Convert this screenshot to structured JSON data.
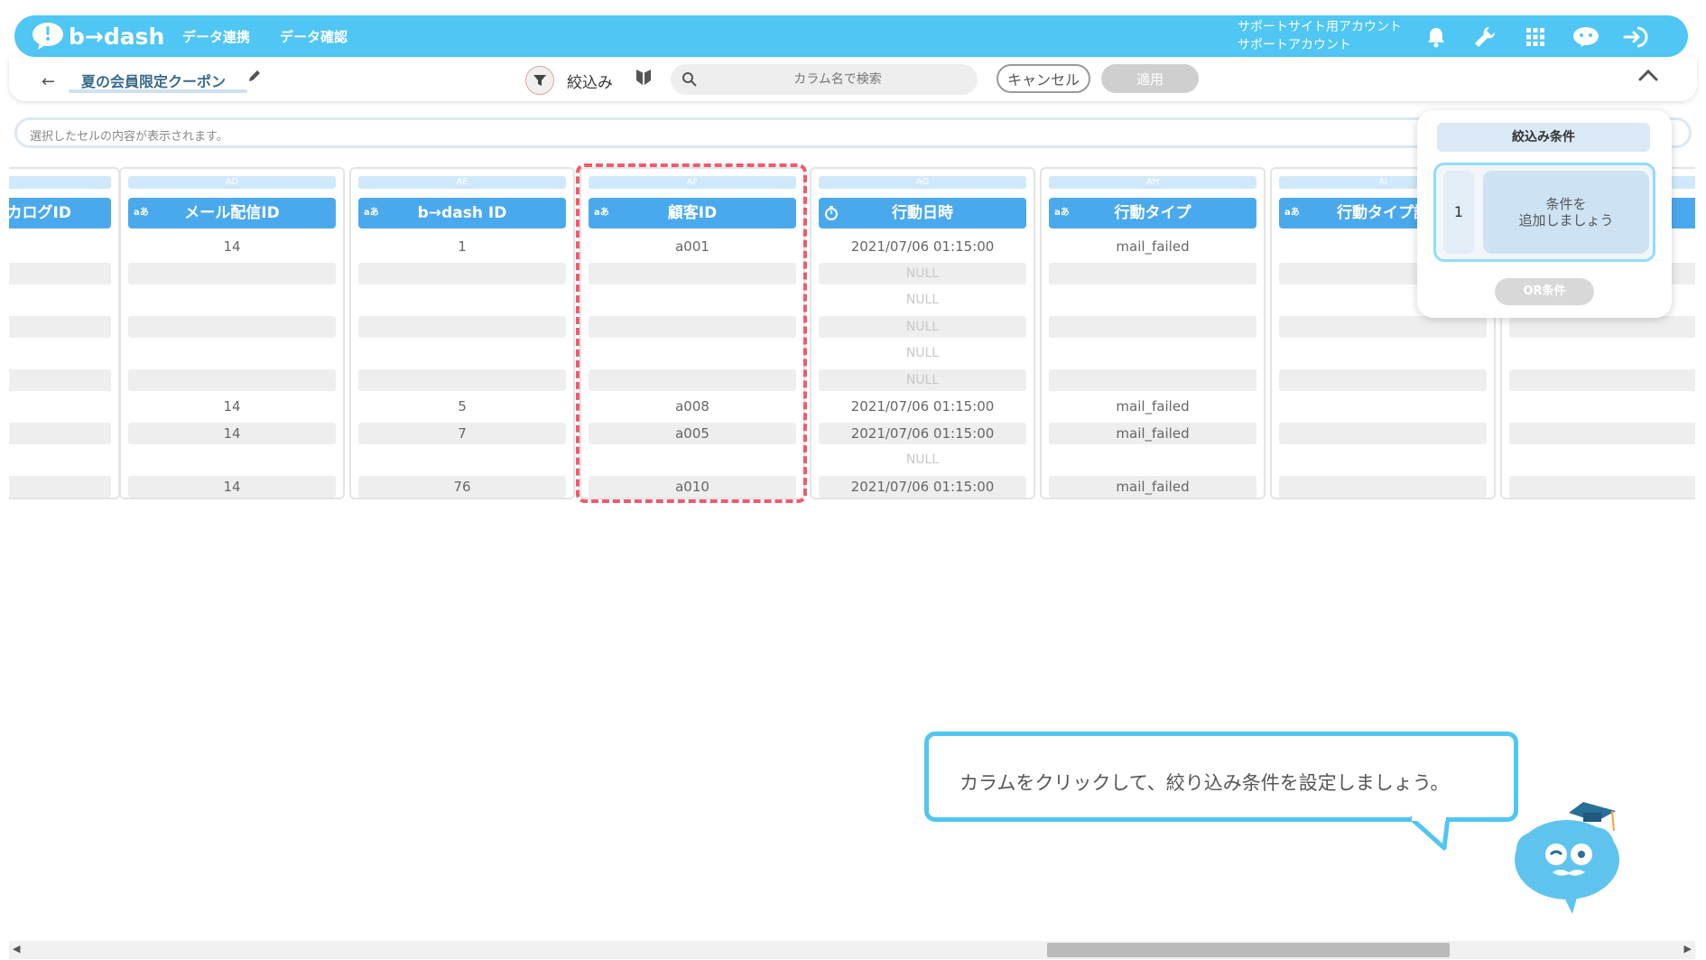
{
  "navbar": {
    "logo_text": "b→dash",
    "links": [
      "データ連携",
      "データ確認"
    ],
    "account_line1": "サポートサイト用アカウント",
    "account_line2": "サポートアカウント",
    "icons": [
      "bell-icon",
      "wrench-icon",
      "grid-apps-icon",
      "mascot-chat-icon",
      "logout-icon"
    ],
    "color": "#4fc6f4"
  },
  "subbar": {
    "title": "夏の会員限定クーポン",
    "filter_label": "絞込み",
    "search_placeholder": "カラム名で検索",
    "cancel_label": "キャンセル",
    "apply_label": "適用"
  },
  "cell_bar": {
    "placeholder": "選択したセルの内容が表示されます。"
  },
  "columns": [
    {
      "letter": "",
      "type": "",
      "name": "カログID",
      "cells": [
        "",
        "",
        "",
        "",
        "",
        "",
        "",
        "",
        "",
        ""
      ]
    },
    {
      "letter": "AD",
      "type": "aあ",
      "name": "メール配信ID",
      "cells": [
        "14",
        "",
        "",
        "",
        "",
        "",
        "14",
        "14",
        "",
        "14"
      ]
    },
    {
      "letter": "AE",
      "type": "aあ",
      "name": "b→dash ID",
      "cells": [
        "1",
        "",
        "",
        "",
        "",
        "",
        "5",
        "7",
        "",
        "76"
      ]
    },
    {
      "letter": "AF",
      "type": "aあ",
      "name": "顧客ID",
      "cells": [
        "a001",
        "",
        "",
        "",
        "",
        "",
        "a008",
        "a005",
        "",
        "a010"
      ]
    },
    {
      "letter": "AG",
      "type": "clock",
      "name": "行動日時",
      "cells": [
        "2021/07/06 01:15:00",
        "NULL",
        "NULL",
        "NULL",
        "NULL",
        "NULL",
        "2021/07/06 01:15:00",
        "2021/07/06 01:15:00",
        "NULL",
        "2021/07/06 01:15:00"
      ]
    },
    {
      "letter": "AH",
      "type": "aあ",
      "name": "行動タイプ",
      "cells": [
        "mail_failed",
        "",
        "",
        "",
        "",
        "",
        "mail_failed",
        "mail_failed",
        "",
        "mail_failed"
      ]
    },
    {
      "letter": "AI",
      "type": "aあ",
      "name": "行動タイプ詳",
      "cells": [
        "",
        "",
        "",
        "",
        "",
        "",
        "",
        "",
        "",
        ""
      ]
    },
    {
      "letter": "",
      "type": "",
      "name": "",
      "cells": [
        "",
        "",
        "",
        "",
        "",
        "",
        "",
        "",
        "",
        ""
      ]
    }
  ],
  "popup": {
    "title": "絞込み条件",
    "cond_number": "1",
    "cond_add_line1": "条件を",
    "cond_add_line2": "追加しましょう",
    "or_label": "OR条件"
  },
  "tooltip": {
    "text": "カラムをクリックして、絞り込み条件を設定しましょう。"
  },
  "colors": {
    "header_blue": "#4aa9ec",
    "highlight_red": "#f05a6c",
    "tooltip_border": "#4fc6f4"
  }
}
